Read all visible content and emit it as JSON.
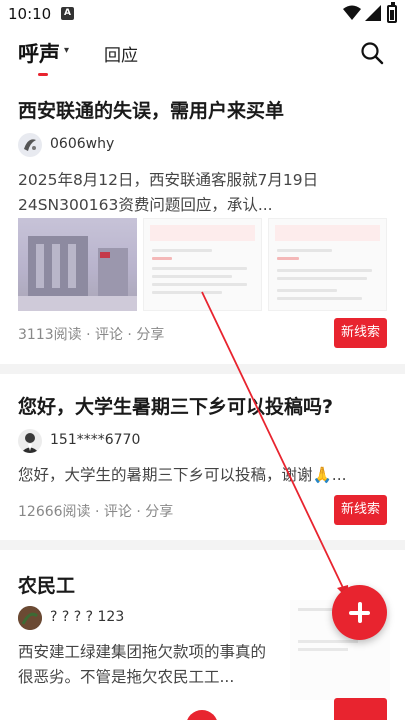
{
  "status_bar": {
    "time": "10:10",
    "notif_glyph": "A"
  },
  "nav": {
    "active_tab": "呼声",
    "caret": "▾",
    "other_tab": "回应",
    "search_icon": "search-icon"
  },
  "posts": [
    {
      "title": "西安联通的失误，需用户来买单",
      "author": "0606why",
      "excerpt": "2025年8月12日，西安联通客服就7月19日24SN300163资费问题回应，承认...",
      "stats": "3113阅读 · 评论 · 分享",
      "lead_label": "新线索"
    },
    {
      "title": "您好，大学生暑期三下乡可以投稿吗?",
      "author": "151****6770",
      "excerpt": "您好，大学生的暑期三下乡可以投稿，谢谢🙏...",
      "stats": "12666阅读 · 评论 · 分享",
      "lead_label": "新线索"
    },
    {
      "title": "农民工",
      "author": "? ? ? ? 123",
      "excerpt": "西安建工绿建集团拖欠款项的事真的很恶劣。不管是拖欠农民工工..."
    }
  ],
  "fab": {
    "icon": "plus-icon"
  },
  "colors": {
    "accent": "#e8242f",
    "divider": "#f3f3f3"
  }
}
